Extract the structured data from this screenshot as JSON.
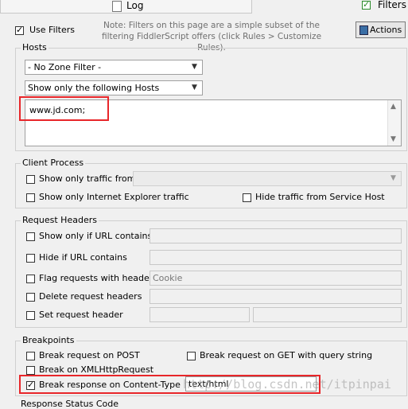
{
  "tabs": {
    "log_label": "Log",
    "filters_label": "Filters"
  },
  "use_filters": {
    "label": "Use Filters",
    "checked": true
  },
  "note": "Note: Filters on this page are a simple subset of the filtering FiddlerScript offers (click Rules > Customize Rules).",
  "actions_label": "Actions",
  "hosts": {
    "title": "Hosts",
    "zone_filter": "- No Zone Filter -",
    "host_filter": "Show only the following Hosts",
    "hosts_text": "www.jd.com;"
  },
  "client_process": {
    "title": "Client Process",
    "show_only_from": "Show only traffic from",
    "show_only_ie": "Show only Internet Explorer traffic",
    "hide_service_host": "Hide traffic from Service Host"
  },
  "request_headers": {
    "title": "Request Headers",
    "show_if_url": "Show only if URL contains",
    "hide_if_url": "Hide if URL contains",
    "flag_headers": "Flag requests with headers",
    "flag_value": "Cookie",
    "delete_headers": "Delete request headers",
    "set_header": "Set request header"
  },
  "breakpoints": {
    "title": "Breakpoints",
    "break_post": "Break request on POST",
    "break_get_qs": "Break request on GET with query string",
    "break_xhr": "Break on XMLHttpRequest",
    "break_response_ct": "Break response on Content-Type",
    "content_type_value": "text/html"
  },
  "next_section_partial": "Response Status Code",
  "watermark": "http://blog.csdn.net/itpinpai",
  "colors": {
    "highlight_red": "#e8262a",
    "filters_check_green": "#2a8a2a"
  }
}
